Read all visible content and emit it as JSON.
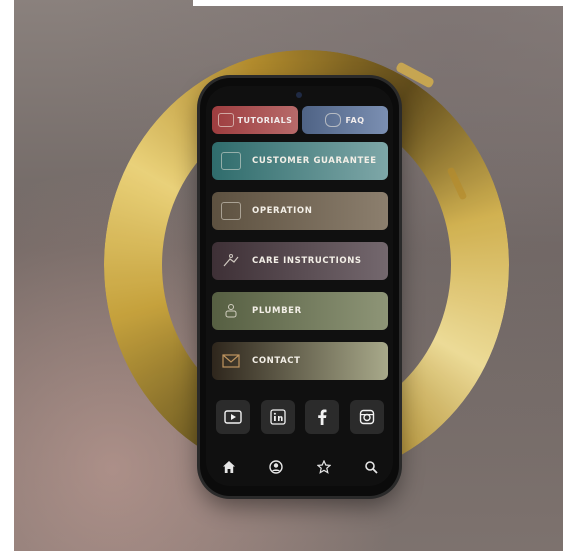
{
  "app": {
    "top_buttons": [
      {
        "label": "TUTORIALS",
        "icon": "tutorial-icon"
      },
      {
        "label": "FAQ",
        "icon": "faq-icon"
      }
    ],
    "menu": [
      {
        "label": "CUSTOMER GUARANTEE",
        "icon": "certificate-icon"
      },
      {
        "label": "OPERATION",
        "icon": "toilet-icon"
      },
      {
        "label": "CARE INSTRUCTIONS",
        "icon": "care-hand-icon"
      },
      {
        "label": "PLUMBER",
        "icon": "plumber-icon"
      },
      {
        "label": "CONTACT",
        "icon": "mail-icon"
      }
    ],
    "social": [
      "youtube-icon",
      "linkedin-icon",
      "facebook-icon",
      "instagram-icon"
    ],
    "nav": [
      "home-icon",
      "user-icon",
      "star-icon",
      "search-icon"
    ]
  },
  "colors": {
    "tutorials": "#9e3d3f",
    "faq": "#4f6385",
    "guarantee": "#2f6c6c",
    "operation": "#5d5140",
    "care": "#3e3036",
    "plumber": "#565f42",
    "contact": "#2e261c",
    "gold": "#c9a43a"
  }
}
